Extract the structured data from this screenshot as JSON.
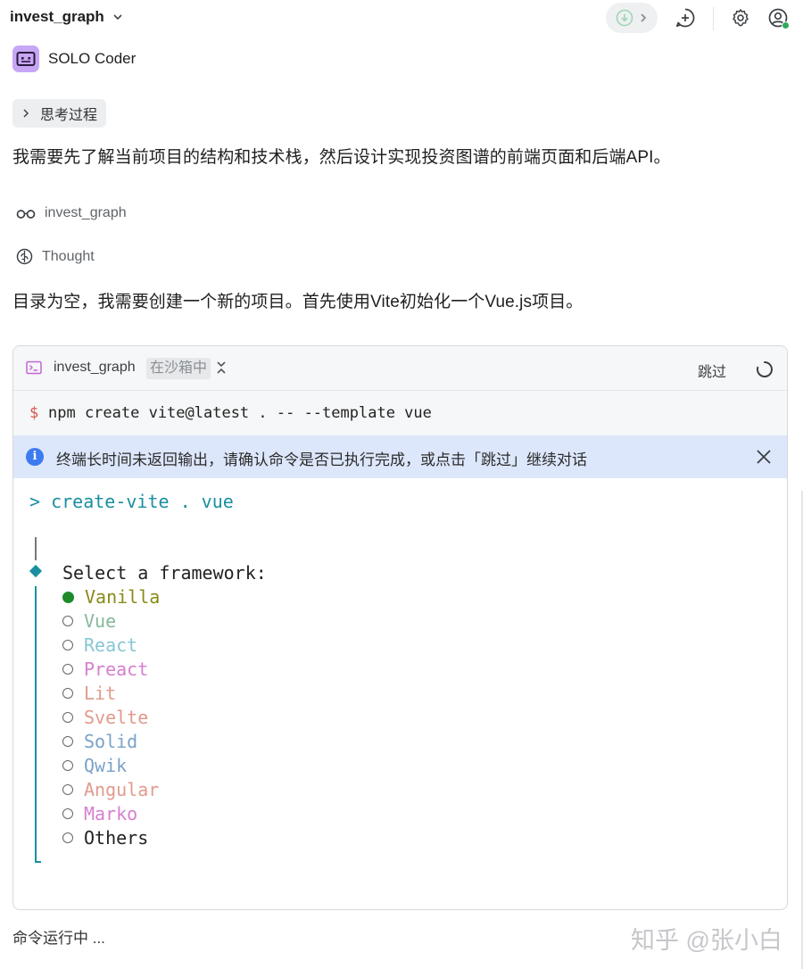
{
  "header": {
    "project_name": "invest_graph"
  },
  "agent": {
    "name": "SOLO Coder"
  },
  "thinking": {
    "label": "思考过程"
  },
  "messages": {
    "intro": "我需要先了解当前项目的结构和技术栈，然后设计实现投资图谱的前端页面和后端API。",
    "followup": "目录为空，我需要创建一个新的项目。首先使用Vite初始化一个Vue.js项目。"
  },
  "steps": {
    "view_label": "invest_graph",
    "thought_label": "Thought"
  },
  "terminal": {
    "title": "invest_graph",
    "sandbox_tag": "在沙箱中",
    "skip_label": "跳过",
    "prompt_symbol": "$",
    "command": "npm create vite@latest . -- --template vue",
    "notice": "终端长时间未返回输出，请确认命令是否已执行完成，或点击「跳过」继续对话",
    "output_prompt": "> create-vite . vue",
    "question": "Select a framework:",
    "frameworks": [
      {
        "label": "Vanilla",
        "color": "#8a8a1a",
        "selected": true
      },
      {
        "label": "Vue",
        "color": "#86b89a",
        "selected": false
      },
      {
        "label": "React",
        "color": "#86c6d4",
        "selected": false
      },
      {
        "label": "Preact",
        "color": "#d77fcf",
        "selected": false
      },
      {
        "label": "Lit",
        "color": "#e29a8c",
        "selected": false
      },
      {
        "label": "Svelte",
        "color": "#e29a8c",
        "selected": false
      },
      {
        "label": "Solid",
        "color": "#7aa2c8",
        "selected": false
      },
      {
        "label": "Qwik",
        "color": "#7aa2c8",
        "selected": false
      },
      {
        "label": "Angular",
        "color": "#e29a8c",
        "selected": false
      },
      {
        "label": "Marko",
        "color": "#d77fcf",
        "selected": false
      },
      {
        "label": "Others",
        "color": "#222222",
        "selected": false
      }
    ]
  },
  "footer": {
    "status": "命令运行中 ...",
    "watermark": "知乎 @张小白"
  },
  "colors": {
    "accent_teal": "#1a8fa0",
    "info_blue": "#3e7bf0",
    "notice_bg": "#dde7fb",
    "online_green": "#2faa5b",
    "agent_purple": "#c7a6f5"
  }
}
